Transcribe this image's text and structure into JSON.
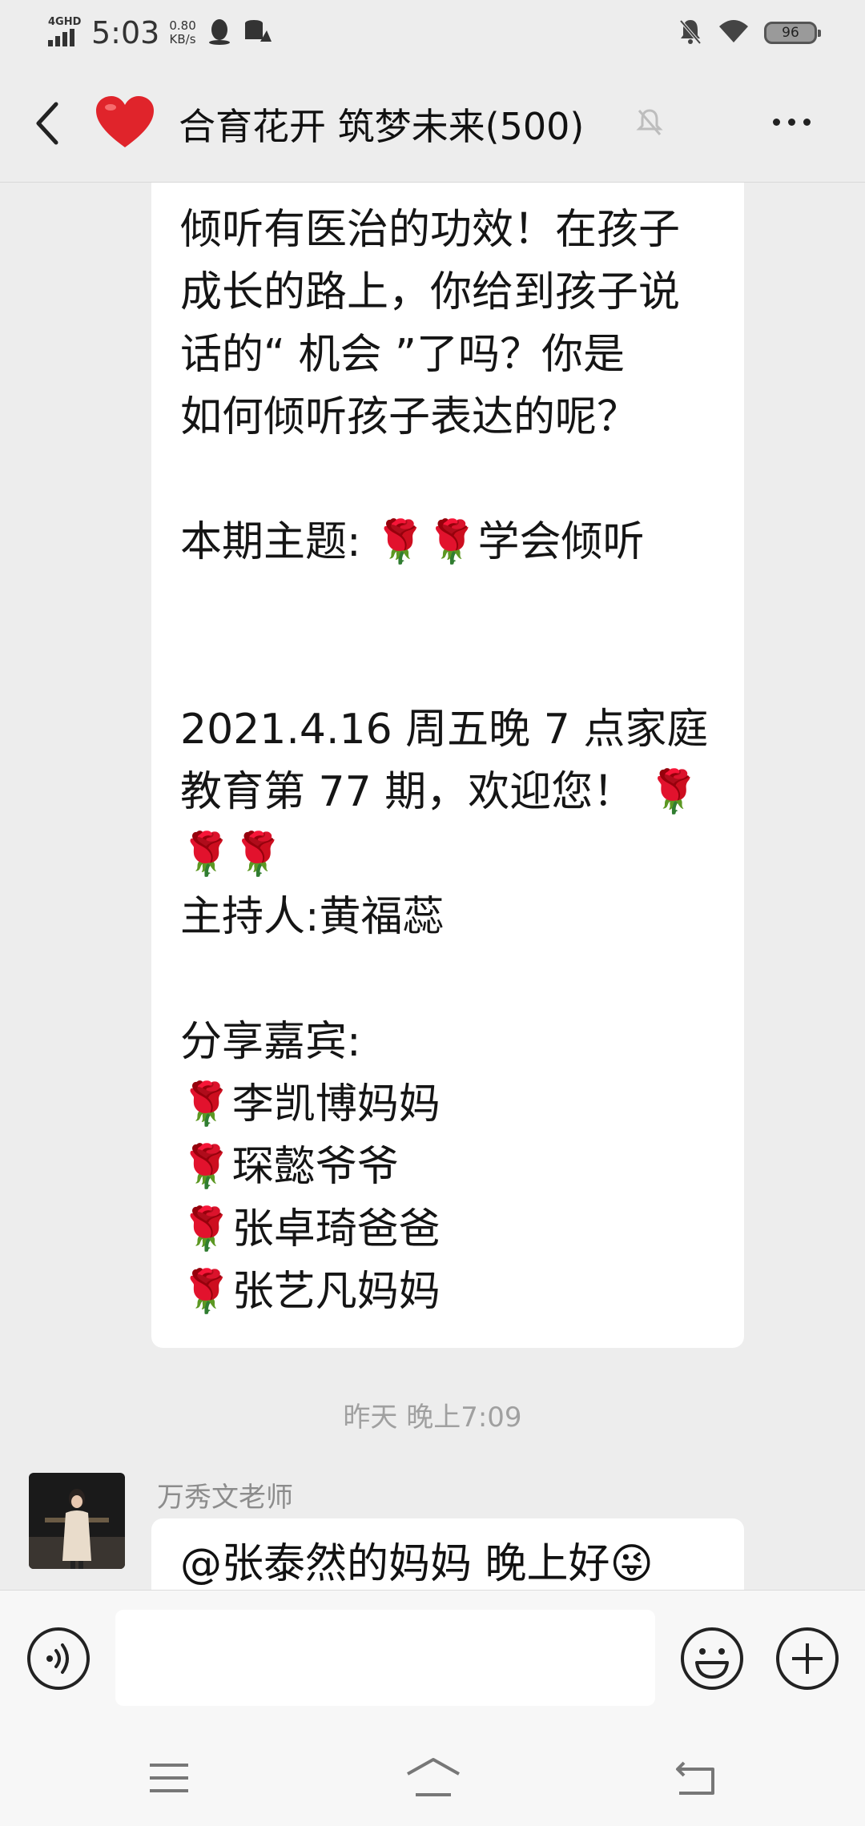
{
  "status_bar": {
    "network": "4GHD",
    "time": "5:03",
    "speed_value": "0.80",
    "speed_unit": "KB/s",
    "battery": "96"
  },
  "header": {
    "title": "合育花开 筑梦未来(500)"
  },
  "messages": [
    {
      "text": "倾听有医治的功效！在孩子\n成长的路上，你给到孩子说\n话的“ 机会 ”了吗？你是\n如何倾听孩子表达的呢？\n\n本期主题: 🌹🌹学会倾听\n\n\n2021.4.16 周五晚 7 点家庭\n教育第 77 期，欢迎您！ 🌹\n🌹🌹\n主持人:黄福蕊\n\n分享嘉宾:\n🌹李凯博妈妈\n🌹琛懿爷爷\n🌹张卓琦爸爸\n🌹张艺凡妈妈"
    }
  ],
  "time_separator": "昨天 晚上7:09",
  "next_message": {
    "sender": "万秀文老师",
    "text": "@张泰然的妈妈  晚上好😜"
  },
  "input": {
    "placeholder": ""
  },
  "icons": {
    "back": "chevron-left-icon",
    "heart": "red-heart-icon",
    "mute": "bell-off-icon",
    "more": "more-dots-icon",
    "voice": "voice-icon",
    "emoji": "emoji-icon",
    "plus": "plus-icon"
  }
}
